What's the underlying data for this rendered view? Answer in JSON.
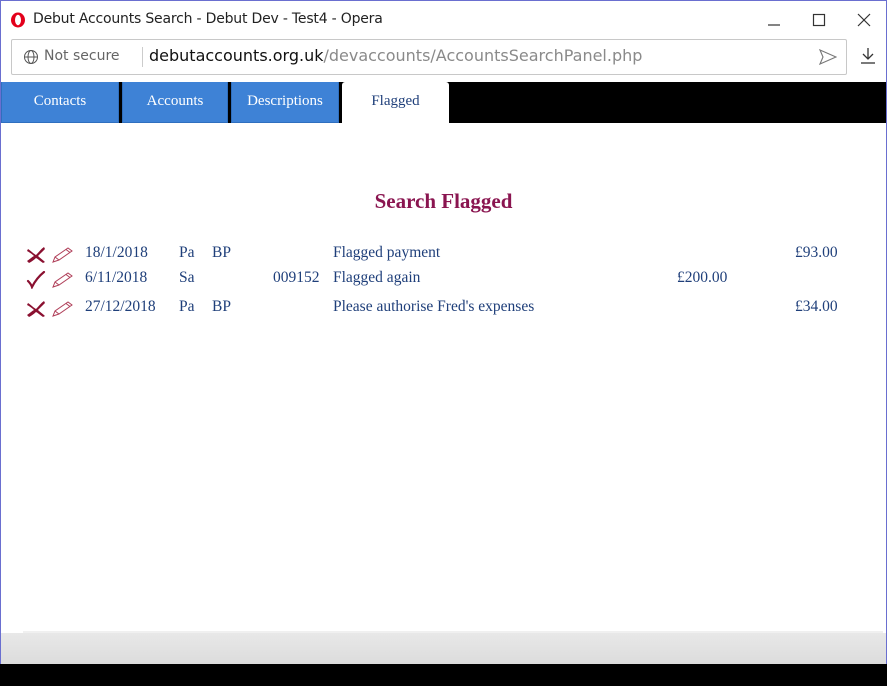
{
  "window": {
    "title": "Debut Accounts Search - Debut Dev - Test4 - Opera"
  },
  "address_bar": {
    "security_label": "Not secure",
    "url_domain": "debutaccounts.org.uk",
    "url_path": "/devaccounts/AccountsSearchPanel.php"
  },
  "tabs": [
    {
      "label": "Contacts"
    },
    {
      "label": "Accounts"
    },
    {
      "label": "Descriptions"
    },
    {
      "label": "Flagged"
    }
  ],
  "page": {
    "title": "Search Flagged"
  },
  "rows": [
    {
      "status": "x-icon",
      "date": "18/1/2018",
      "type": "Pa",
      "code": "BP",
      "ref": "",
      "description": "Flagged payment",
      "amount_in": "",
      "amount_out": "£93.00"
    },
    {
      "status": "check-icon",
      "date": "6/11/2018",
      "type": "Sa",
      "code": "",
      "ref": "009152",
      "description": "Flagged again",
      "amount_in": "£200.00",
      "amount_out": ""
    },
    {
      "status": "x-icon",
      "date": "27/12/2018",
      "type": "Pa",
      "code": "BP",
      "ref": "",
      "description": "Please authorise Fred's expenses",
      "amount_in": "",
      "amount_out": "£34.00"
    }
  ],
  "colors": {
    "tab_inactive": "#3e82d6",
    "title": "#8a1550",
    "row_text": "#1f3f7a",
    "icon_red": "#8a1030"
  }
}
